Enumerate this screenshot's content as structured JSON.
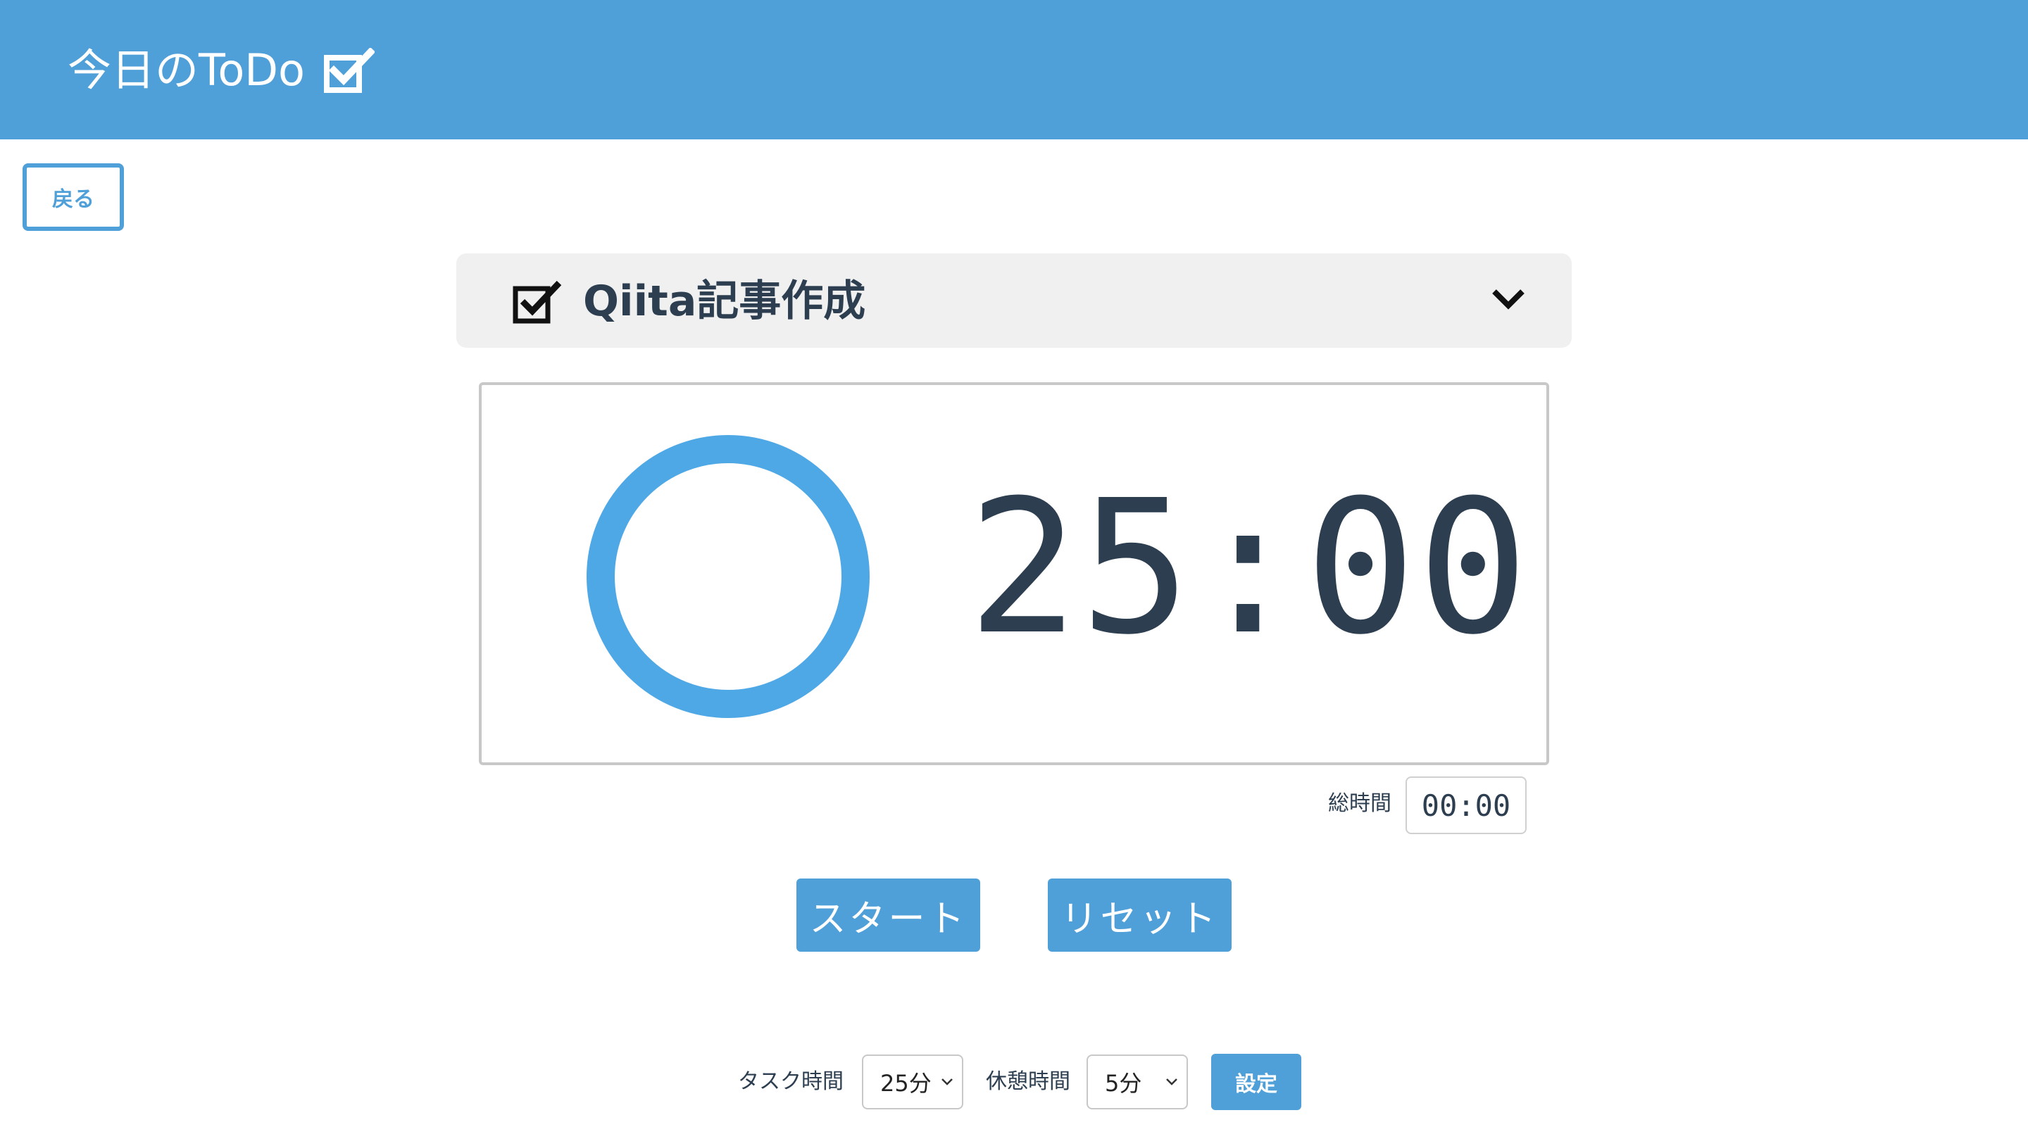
{
  "header": {
    "title": "今日のToDo",
    "icon": "checkbox-checked-icon",
    "color": "#4f9fd8"
  },
  "back_button": {
    "label": "戻る"
  },
  "task": {
    "title": "Qiita記事作成",
    "check_icon": "checkbox-checked-icon",
    "toggle_icon": "chevron-down-icon"
  },
  "timer": {
    "display": "25:00",
    "progress_ring_color": "#4fa8e6",
    "progress": 1.0
  },
  "total": {
    "label": "総時間",
    "value": "00:00"
  },
  "controls": {
    "start_label": "スタート",
    "reset_label": "リセット"
  },
  "settings": {
    "task_time_label": "タスク時間",
    "task_time_value": "25分",
    "break_time_label": "休憩時間",
    "break_time_value": "5分",
    "set_label": "設定"
  }
}
